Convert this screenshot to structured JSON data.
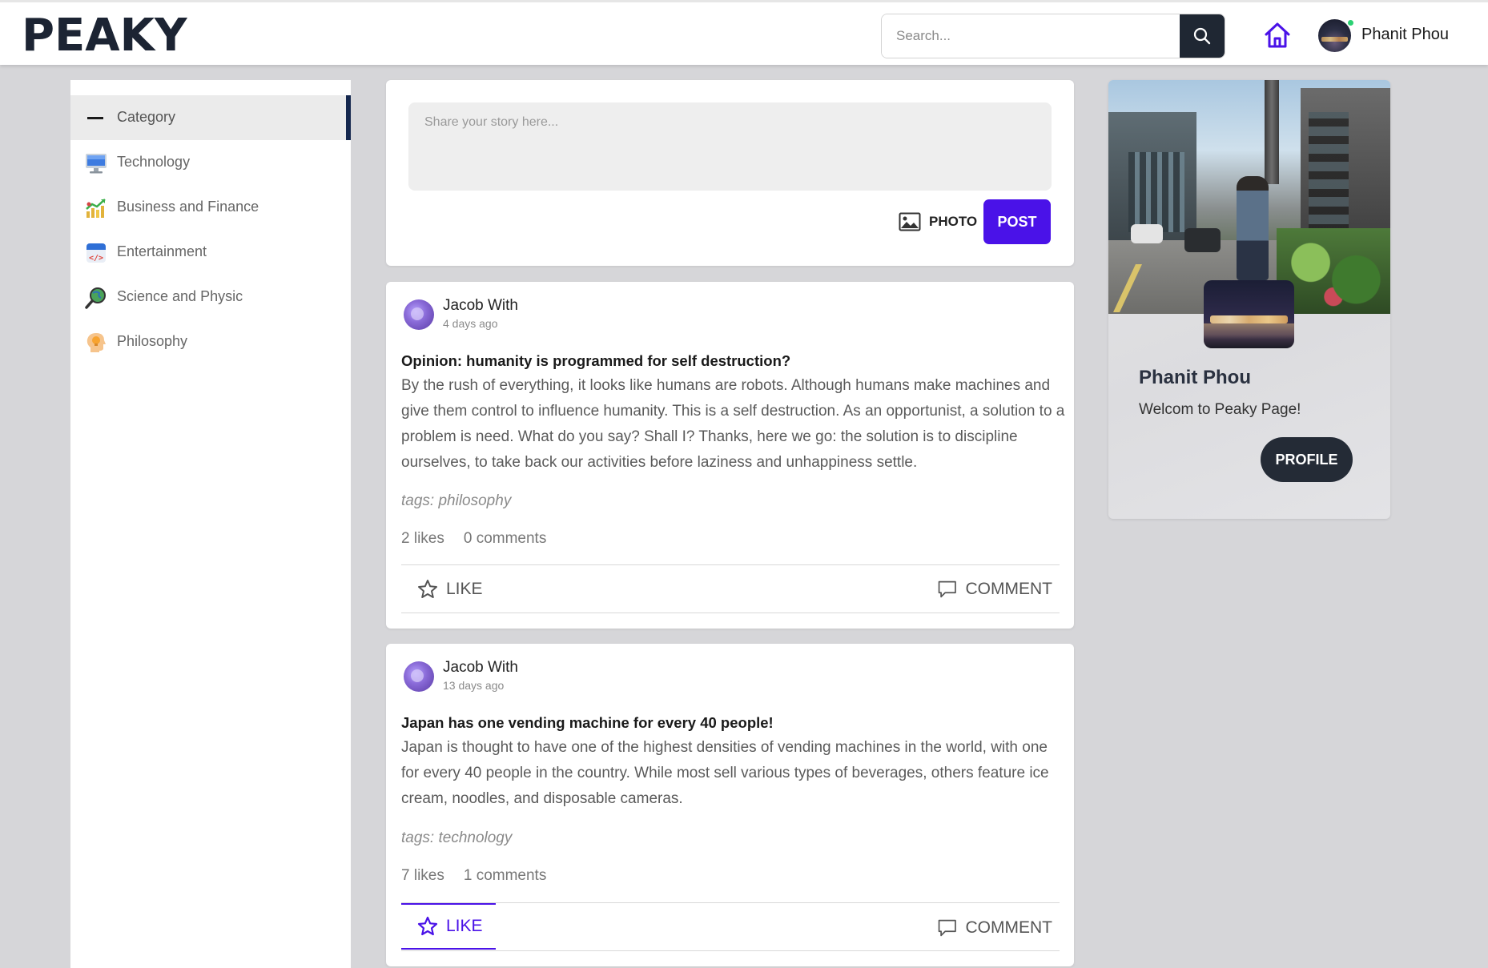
{
  "header": {
    "logo": "PEAKY",
    "search_placeholder": "Search...",
    "username": "Phanit Phou",
    "icons": {
      "search": "search-icon",
      "home": "home-icon"
    },
    "accent_color": "#4a12e8"
  },
  "sidebar": {
    "category_label": "Category",
    "items": [
      {
        "label": "Technology",
        "icon": "computer-icon"
      },
      {
        "label": "Business and Finance",
        "icon": "chart-money-icon"
      },
      {
        "label": "Entertainment",
        "icon": "code-window-icon"
      },
      {
        "label": "Science and Physic",
        "icon": "magnifier-globe-icon"
      },
      {
        "label": "Philosophy",
        "icon": "head-idea-icon"
      }
    ]
  },
  "composer": {
    "placeholder": "Share your story here...",
    "photo_label": "PHOTO",
    "post_label": "POST"
  },
  "posts": [
    {
      "author": "Jacob With",
      "time": "4 days ago",
      "title": "Opinion: humanity is programmed for self destruction?",
      "body": "By the rush of everything, it looks like humans are robots. Although humans make machines and give them control to influence humanity. This is a self destruction. As an opportunist, a solution to a problem is need. What do you say? Shall I? Thanks, here we go: the solution is to discipline ourselves, to take back our activities before laziness and unhappiness settle.",
      "tags": "tags: philosophy",
      "likes": "2 likes",
      "comments": "0 comments",
      "like_label": "LIKE",
      "comment_label": "COMMENT",
      "liked": false
    },
    {
      "author": "Jacob With",
      "time": "13 days ago",
      "title": "Japan has one vending machine for every 40 people!",
      "body": "Japan is thought to have one of the highest densities of vending machines in the world, with one for every 40 people in the country. While most sell various types of beverages, others feature ice cream, noodles, and disposable cameras.",
      "tags": "tags: technology",
      "likes": "7 likes",
      "comments": "1 comments",
      "like_label": "LIKE",
      "comment_label": "COMMENT",
      "liked": true
    }
  ],
  "profile": {
    "name": "Phanit Phou",
    "welcome": "Welcom to Peaky Page!",
    "button_label": "PROFILE"
  }
}
